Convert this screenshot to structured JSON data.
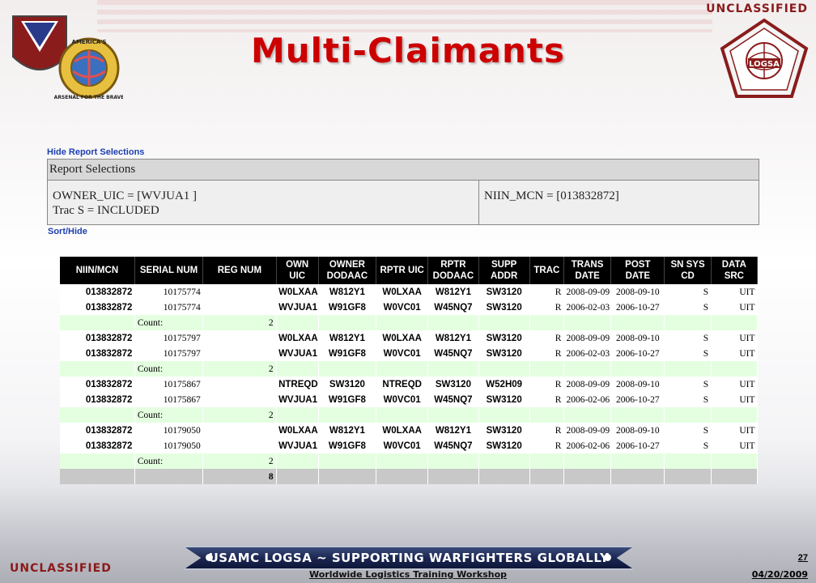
{
  "classification": "UNCLASSIFIED",
  "slide_title": "Multi-Claimants",
  "left_logo_text": "AMERICA'S ARSENAL FOR THE BRAVE",
  "right_logo_text": "LOGSA",
  "links": {
    "hide_report": "Hide Report Selections",
    "sort_hide": "Sort/Hide"
  },
  "report_selections": {
    "header": "Report Selections",
    "owner_uic": "OWNER_UIC = [WVJUA1 ]",
    "trac": "Trac S = INCLUDED",
    "niin_mcn": "NIIN_MCN = [013832872]"
  },
  "table": {
    "columns": [
      "NIIN/MCN",
      "SERIAL NUM",
      "REG NUM",
      "OWN UIC",
      "OWNER DODAAC",
      "RPTR UIC",
      "RPTR DODAAC",
      "SUPP ADDR",
      "TRAC",
      "TRANS DATE",
      "POST DATE",
      "SN SYS CD",
      "DATA SRC"
    ],
    "count_label": "Count:",
    "groups": [
      {
        "rows": [
          [
            "013832872",
            "10175774",
            "",
            "W0LXAA",
            "W812Y1",
            "W0LXAA",
            "W812Y1",
            "SW3120",
            "R",
            "2008-09-09",
            "2008-09-10",
            "S",
            "UIT"
          ],
          [
            "013832872",
            "10175774",
            "",
            "WVJUA1",
            "W91GF8",
            "W0VC01",
            "W45NQ7",
            "SW3120",
            "R",
            "2006-02-03",
            "2006-10-27",
            "S",
            "UIT"
          ]
        ],
        "count": "2"
      },
      {
        "rows": [
          [
            "013832872",
            "10175797",
            "",
            "W0LXAA",
            "W812Y1",
            "W0LXAA",
            "W812Y1",
            "SW3120",
            "R",
            "2008-09-09",
            "2008-09-10",
            "S",
            "UIT"
          ],
          [
            "013832872",
            "10175797",
            "",
            "WVJUA1",
            "W91GF8",
            "W0VC01",
            "W45NQ7",
            "SW3120",
            "R",
            "2006-02-03",
            "2006-10-27",
            "S",
            "UIT"
          ]
        ],
        "count": "2"
      },
      {
        "rows": [
          [
            "013832872",
            "10175867",
            "",
            "NTREQD",
            "SW3120",
            "NTREQD",
            "SW3120",
            "W52H09",
            "R",
            "2008-09-09",
            "2008-09-10",
            "S",
            "UIT"
          ],
          [
            "013832872",
            "10175867",
            "",
            "WVJUA1",
            "W91GF8",
            "W0VC01",
            "W45NQ7",
            "SW3120",
            "R",
            "2006-02-06",
            "2006-10-27",
            "S",
            "UIT"
          ]
        ],
        "count": "2"
      },
      {
        "rows": [
          [
            "013832872",
            "10179050",
            "",
            "W0LXAA",
            "W812Y1",
            "W0LXAA",
            "W812Y1",
            "SW3120",
            "R",
            "2008-09-09",
            "2008-09-10",
            "S",
            "UIT"
          ],
          [
            "013832872",
            "10179050",
            "",
            "WVJUA1",
            "W91GF8",
            "W0VC01",
            "W45NQ7",
            "SW3120",
            "R",
            "2006-02-06",
            "2006-10-27",
            "S",
            "UIT"
          ]
        ],
        "count": "2"
      }
    ],
    "total": "8"
  },
  "footer": {
    "banner": "USAMC LOGSA ~ SUPPORTING WARFIGHTERS GLOBALLY",
    "workshop": "Worldwide Logistics Training Workshop",
    "page_number": "27",
    "date": "04/20/2009"
  },
  "colors": {
    "title": "#cc0000",
    "classification": "#8b1a1a",
    "link": "#1c3fb0",
    "header_bg": "#000000",
    "count_row": "#e4ffe0",
    "total_row": "#c8c8c8"
  }
}
